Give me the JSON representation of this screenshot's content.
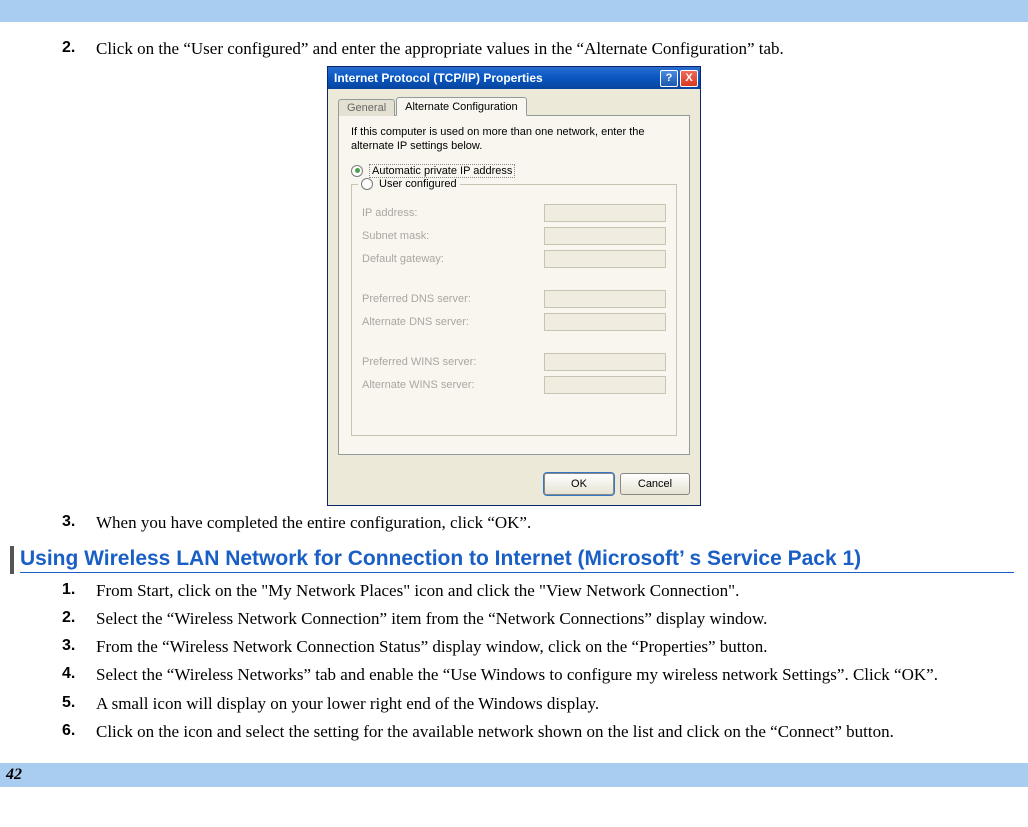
{
  "page": {
    "number": "42"
  },
  "upper": {
    "steps": [
      {
        "num": "2.",
        "text": "Click on the “User configured” and enter the appropriate values in the “Alternate Configuration” tab."
      },
      {
        "num": "3.",
        "text": "When you have completed the entire configuration, click “OK”."
      }
    ]
  },
  "dialog": {
    "title": "Internet Protocol (TCP/IP) Properties",
    "help": "?",
    "close": "X",
    "tabs": {
      "general": "General",
      "alt": "Alternate Configuration"
    },
    "instruction": "If this computer is used on more than one network, enter the alternate IP settings below.",
    "radios": {
      "auto": "Automatic private IP address",
      "user": "User configured"
    },
    "fields": {
      "ip": "IP address:",
      "subnet": "Subnet mask:",
      "gateway": "Default gateway:",
      "pdns": "Preferred DNS server:",
      "adns": "Alternate DNS server:",
      "pwins": "Preferred WINS server:",
      "awins": "Alternate WINS server:"
    },
    "buttons": {
      "ok": "OK",
      "cancel": "Cancel"
    }
  },
  "section2": {
    "heading": "Using Wireless LAN Network for Connection to Internet (Microsoft’ s Service Pack 1)",
    "steps": [
      {
        "num": "1.",
        "text": "From Start, click on the \"My Network Places\" icon and click the \"View Network Connection\"."
      },
      {
        "num": "2.",
        "text": "Select the “Wireless Network Connection” item from the “Network Connections” display window."
      },
      {
        "num": "3.",
        "text": "From the “Wireless Network Connection Status” display window, click on the “Properties” button."
      },
      {
        "num": "4.",
        "text": "Select the “Wireless Networks” tab and enable the “Use Windows to configure my wireless network Settings”. Click “OK”."
      },
      {
        "num": "5.",
        "text": "A small icon will display on your lower right end of the Windows display."
      },
      {
        "num": "6.",
        "text": "Click on the icon and select the setting for the available network shown on the list and click on the “Connect” button."
      }
    ]
  }
}
